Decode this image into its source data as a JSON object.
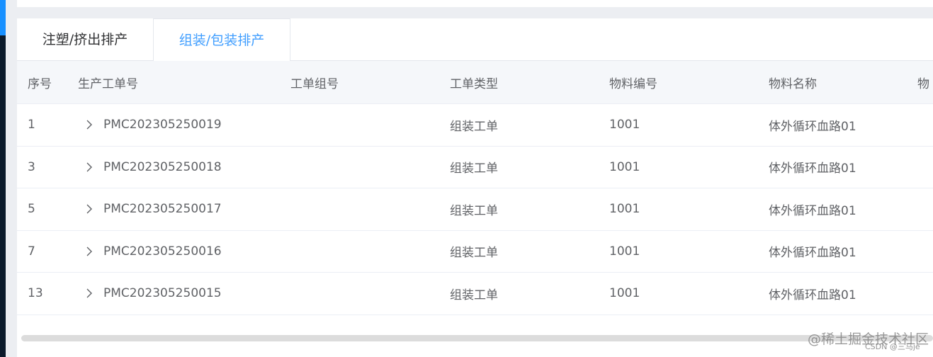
{
  "tabs": [
    {
      "label": "注塑/挤出排产",
      "active": false
    },
    {
      "label": "组装/包装排产",
      "active": true
    }
  ],
  "table": {
    "headers": {
      "seq": "序号",
      "order": "生产工单号",
      "group": "工单组号",
      "type": "工单类型",
      "material_code": "物料编号",
      "material_name": "物料名称",
      "extra": "物"
    },
    "rows": [
      {
        "seq": "1",
        "order": "PMC202305250019",
        "group": "",
        "type": "组装工单",
        "material_code": "1001",
        "material_name": "体外循环血路01"
      },
      {
        "seq": "3",
        "order": "PMC202305250018",
        "group": "",
        "type": "组装工单",
        "material_code": "1001",
        "material_name": "体外循环血路01"
      },
      {
        "seq": "5",
        "order": "PMC202305250017",
        "group": "",
        "type": "组装工单",
        "material_code": "1001",
        "material_name": "体外循环血路01"
      },
      {
        "seq": "7",
        "order": "PMC202305250016",
        "group": "",
        "type": "组装工单",
        "material_code": "1001",
        "material_name": "体外循环血路01"
      },
      {
        "seq": "13",
        "order": "PMC202305250015",
        "group": "",
        "type": "组装工单",
        "material_code": "1001",
        "material_name": "体外循环血路01"
      }
    ]
  },
  "watermark": {
    "main": "@稀土掘金技术社区",
    "small": "CSDN @三马je"
  },
  "colors": {
    "active_tab": "#409eff",
    "header_bg": "#f5f7fa",
    "border": "#ebeef5",
    "text": "#606266"
  }
}
